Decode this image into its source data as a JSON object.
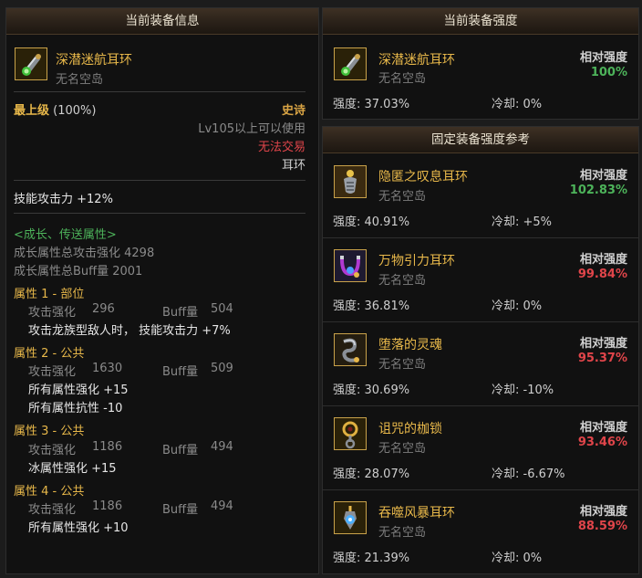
{
  "left_panel": {
    "title": "当前装备信息",
    "item": {
      "name": "深潜迷航耳环",
      "source": "无名空岛",
      "icon": "earring-icon"
    },
    "level_label": "最上级",
    "level_value": "(100%)",
    "rarity": "史诗",
    "level_req": "Lv105以上可以使用",
    "trade": "无法交易",
    "slot": "耳环",
    "skill_attack": "技能攻击力 +12%",
    "growth_header": "<成长、传送属性>",
    "growth_attack": "成长属性总攻击强化 4298",
    "growth_buff": "成长属性总Buff量 2001",
    "attrs": [
      {
        "title": "属性 1 - 部位",
        "attack_label": "攻击强化",
        "attack_value": "296",
        "buff_label": "Buff量",
        "buff_value": "504",
        "effects": [
          "攻击龙族型敌人时， 技能攻击力 +7%"
        ]
      },
      {
        "title": "属性 2 - 公共",
        "attack_label": "攻击强化",
        "attack_value": "1630",
        "buff_label": "Buff量",
        "buff_value": "509",
        "effects": [
          "所有属性强化 +15",
          "所有属性抗性 -10"
        ]
      },
      {
        "title": "属性 3 - 公共",
        "attack_label": "攻击强化",
        "attack_value": "1186",
        "buff_label": "Buff量",
        "buff_value": "494",
        "effects": [
          "冰属性强化 +15"
        ]
      },
      {
        "title": "属性 4 - 公共",
        "attack_label": "攻击强化",
        "attack_value": "1186",
        "buff_label": "Buff量",
        "buff_value": "494",
        "effects": [
          "所有属性强化 +10"
        ]
      }
    ]
  },
  "current_panel": {
    "title": "当前装备强度",
    "item": {
      "name": "深潜迷航耳环",
      "source": "无名空岛",
      "icon": "earring-icon"
    },
    "relative_label": "相对强度",
    "relative_value": "100%",
    "strength": "强度: 37.03%",
    "cooldown": "冷却: 0%"
  },
  "reference_panel": {
    "title": "固定装备强度参考",
    "items": [
      {
        "name": "隐匿之叹息耳环",
        "source": "无名空岛",
        "relative_label": "相对强度",
        "relative_value": "102.83%",
        "status": "green",
        "strength": "强度: 40.91%",
        "cooldown": "冷却: +5%",
        "icon": "sigh-earring-icon"
      },
      {
        "name": "万物引力耳环",
        "source": "无名空岛",
        "relative_label": "相对强度",
        "relative_value": "99.84%",
        "status": "red",
        "strength": "强度: 36.81%",
        "cooldown": "冷却: 0%",
        "icon": "gravity-earring-icon"
      },
      {
        "name": "堕落的灵魂",
        "source": "无名空岛",
        "relative_label": "相对强度",
        "relative_value": "95.37%",
        "status": "red",
        "strength": "强度: 30.69%",
        "cooldown": "冷却: -10%",
        "icon": "fallen-soul-icon"
      },
      {
        "name": "诅咒的枷锁",
        "source": "无名空岛",
        "relative_label": "相对强度",
        "relative_value": "93.46%",
        "status": "red",
        "strength": "强度: 28.07%",
        "cooldown": "冷却: -6.67%",
        "icon": "cursed-shackle-icon"
      },
      {
        "name": "吞噬风暴耳环",
        "source": "无名空岛",
        "relative_label": "相对强度",
        "relative_value": "88.59%",
        "status": "red",
        "strength": "强度: 21.39%",
        "cooldown": "冷却: 0%",
        "icon": "storm-earring-icon"
      }
    ]
  },
  "colors": {
    "gold": "#e8b84a",
    "green": "#4db35a",
    "red": "#e0454a",
    "growth_green": "#4db35a",
    "background": "#111111",
    "header_brown": "#2a2119"
  }
}
